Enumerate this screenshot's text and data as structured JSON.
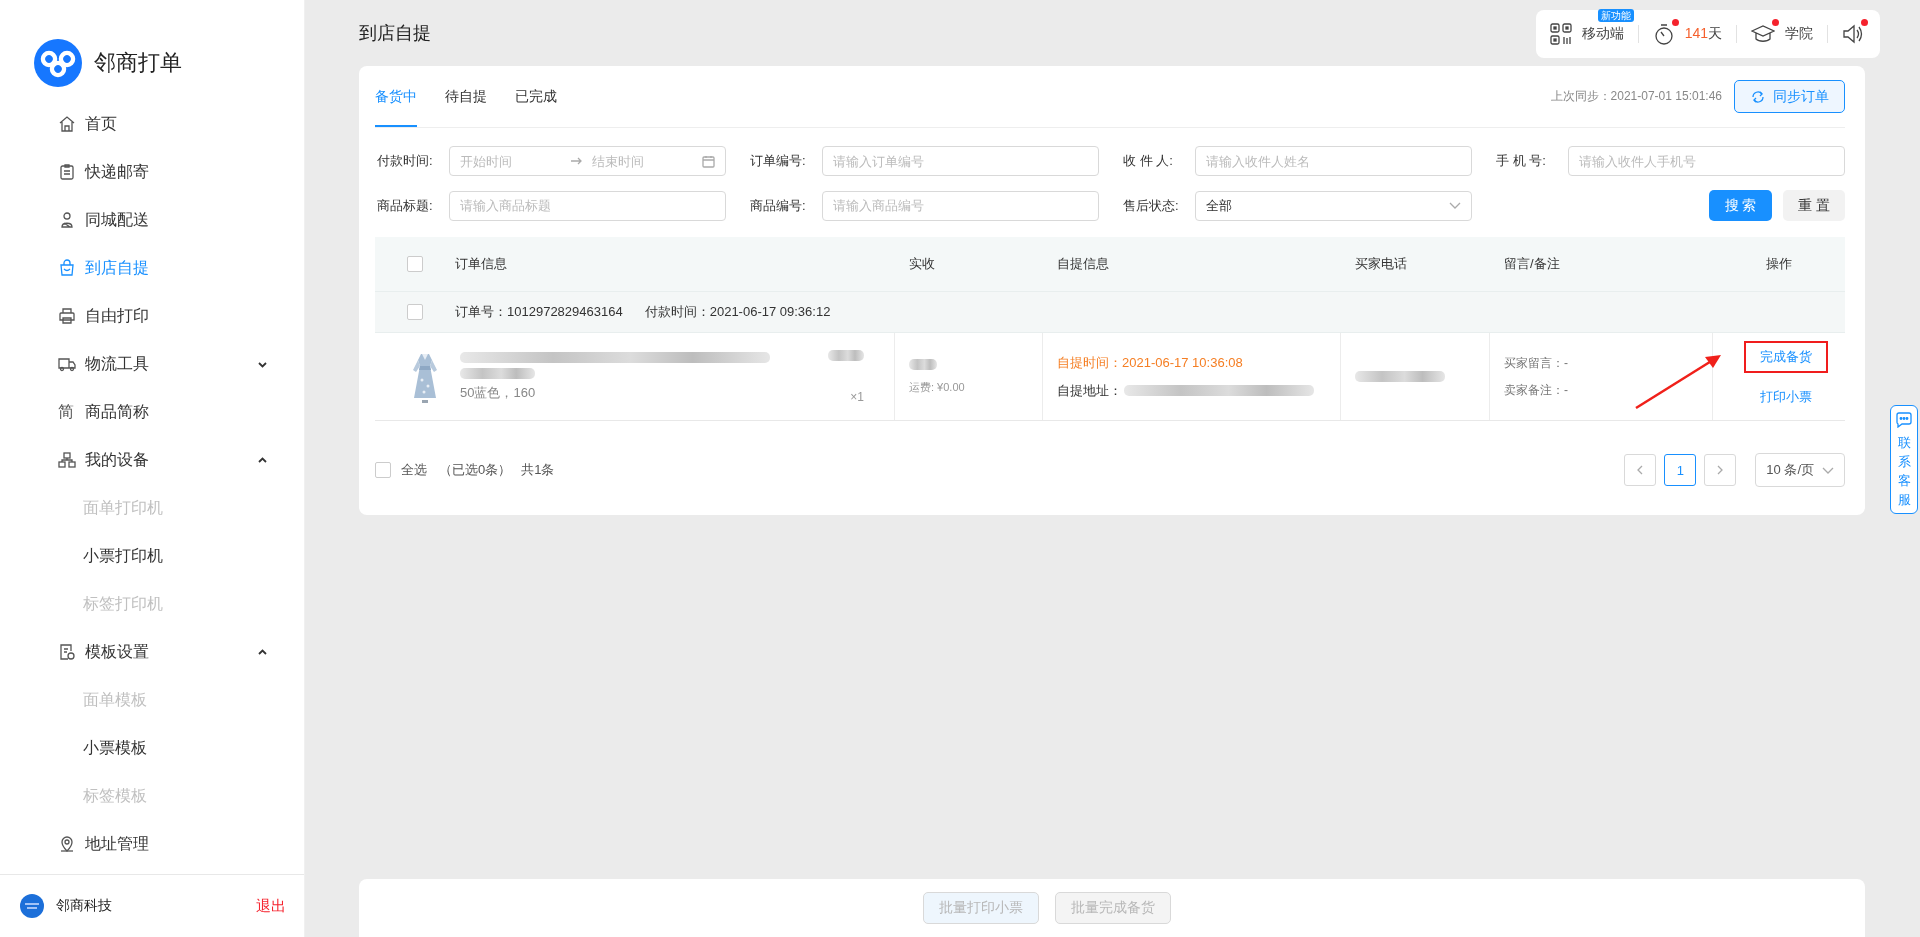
{
  "app": {
    "name": "邻商打单"
  },
  "sidebar": {
    "items": [
      {
        "label": "首页",
        "kind": "home",
        "selected": false
      },
      {
        "label": "快递邮寄",
        "kind": "clipboard",
        "selected": false
      },
      {
        "label": "同城配送",
        "kind": "courier",
        "selected": false
      },
      {
        "label": "到店自提",
        "kind": "bag",
        "selected": true
      },
      {
        "label": "自由打印",
        "kind": "printer",
        "selected": false
      },
      {
        "label": "物流工具",
        "kind": "truck",
        "selected": false,
        "expanded": false
      },
      {
        "label": "商品简称",
        "kind": "glyph",
        "glyph": "简",
        "selected": false
      },
      {
        "label": "我的设备",
        "kind": "devices",
        "selected": false,
        "expanded": true,
        "children": [
          {
            "label": "面单打印机",
            "disabled": true,
            "selected": false
          },
          {
            "label": "小票打印机",
            "disabled": false,
            "selected": false
          },
          {
            "label": "标签打印机",
            "disabled": true,
            "selected": false
          }
        ]
      },
      {
        "label": "模板设置",
        "kind": "template",
        "selected": false,
        "expanded": true,
        "children": [
          {
            "label": "面单模板",
            "disabled": true,
            "selected": false
          },
          {
            "label": "小票模板",
            "disabled": false,
            "selected": false
          },
          {
            "label": "标签模板",
            "disabled": true,
            "selected": false
          }
        ]
      },
      {
        "label": "地址管理",
        "kind": "pin",
        "selected": false
      }
    ]
  },
  "account": {
    "company": "邻商科技",
    "logout": "退出"
  },
  "page_title": "到店自提",
  "toolbar": [
    {
      "kind": "qr",
      "label": "移动端",
      "badge": "新功能"
    },
    {
      "kind": "timer",
      "count": "141",
      "unit": "天",
      "dot": true
    },
    {
      "kind": "academy",
      "label": "学院",
      "dot": true
    },
    {
      "kind": "sound",
      "dot": true
    }
  ],
  "tabs": [
    {
      "label": "备货中",
      "selected": true
    },
    {
      "label": "待自提",
      "selected": false
    },
    {
      "label": "已完成",
      "selected": false
    }
  ],
  "sync": {
    "last": "上次同步：2021-07-01 15:01:46",
    "button": "同步订单"
  },
  "filters": [
    {
      "kind": "daterange",
      "label": "付款时间:",
      "start_placeholder": "开始时间",
      "end_placeholder": "结束时间"
    },
    {
      "kind": "text",
      "label": "订单编号:",
      "placeholder": "请输入订单编号"
    },
    {
      "kind": "text",
      "label": "收 件 人:",
      "placeholder": "请输入收件人姓名"
    },
    {
      "kind": "text",
      "label": "手 机 号:",
      "placeholder": "请输入收件人手机号"
    },
    {
      "kind": "text",
      "label": "商品标题:",
      "placeholder": "请输入商品标题"
    },
    {
      "kind": "text",
      "label": "商品编号:",
      "placeholder": "请输入商品编号"
    },
    {
      "kind": "select",
      "label": "售后状态:",
      "value": "全部"
    }
  ],
  "filter_buttons": {
    "search": "搜 索",
    "reset": "重 置"
  },
  "table": {
    "all_checked": false,
    "columns": [
      "订单信息",
      "实收",
      "自提信息",
      "买家电话",
      "留言/备注",
      "操作"
    ],
    "orders": [
      {
        "checked": false,
        "order_no": "订单号：1012972829463164",
        "pay_time": "付款时间：2021-06-17 09:36:12",
        "item": {
          "spec": "50蓝色，160",
          "qty": "×1"
        },
        "shipping": "运费: ¥0.00",
        "pickup_time": "自提时间：2021-06-17 10:36:08",
        "pickup_address": "自提地址：",
        "buyer_message": "买家留言：-",
        "seller_note": "卖家备注：-",
        "actions": [
          {
            "label": "完成备货",
            "highlighted": true
          },
          {
            "label": "打印小票",
            "highlighted": false
          }
        ]
      }
    ]
  },
  "list_footer": {
    "select_all": "全选",
    "select_all_checked": false,
    "selected_count": "（已选0条）",
    "total": "共1条"
  },
  "pagination": {
    "pages": [
      {
        "label": "1",
        "selected": true
      }
    ],
    "page_size": "10 条/页"
  },
  "batch_buttons": [
    {
      "label": "批量打印小票",
      "kind": "primary",
      "disabled": true
    },
    {
      "label": "批量完成备货",
      "kind": "default",
      "disabled": true
    }
  ],
  "contact": {
    "label": "联系客服"
  }
}
